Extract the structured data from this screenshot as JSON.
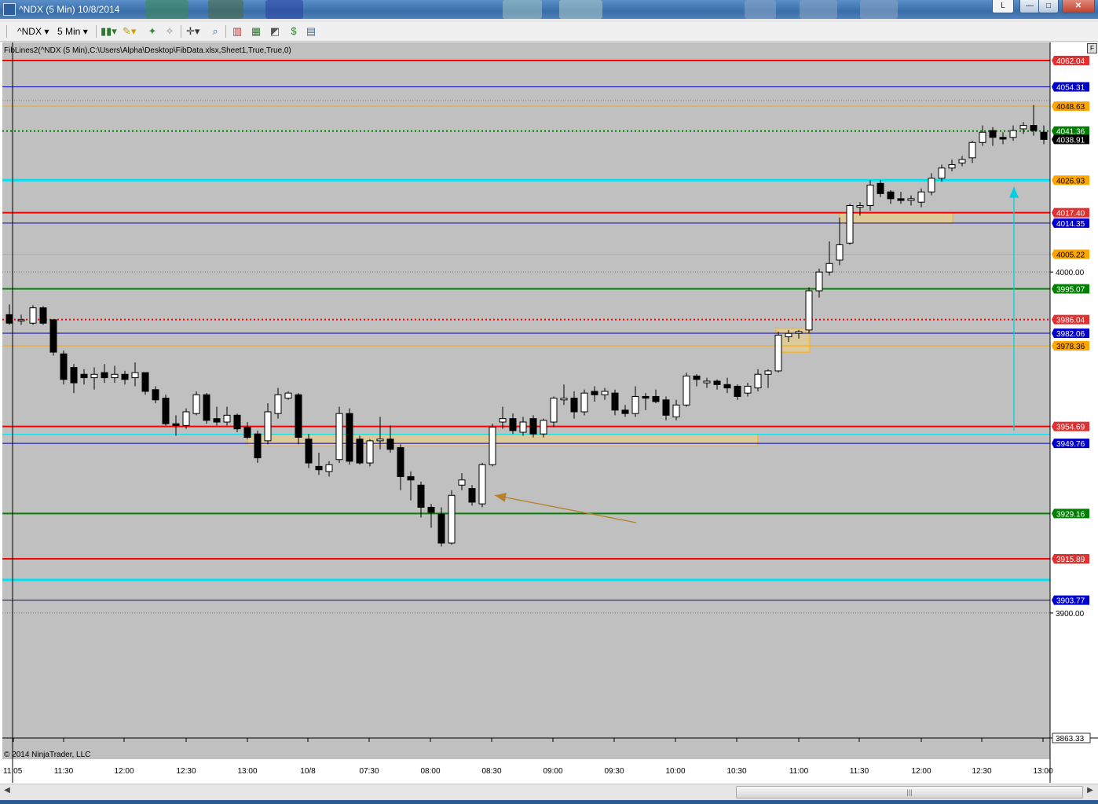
{
  "window": {
    "title": "^NDX (5 Min)  10/8/2014",
    "tab_label": "L",
    "min_glyph": "—",
    "max_glyph": "□",
    "close_glyph": "✕"
  },
  "toolbar": {
    "instrument": "^NDX",
    "interval": "5 Min",
    "icons": [
      "bar-type-icon",
      "drawing-pencil-icon",
      "crosshair-icon",
      "zoom-icon",
      "data-box-icon",
      "chart-properties-icon",
      "strategy-icon",
      "template-icon",
      "window-linking-icon"
    ]
  },
  "indicator_label": "FibLines2(^NDX (5 Min),C:\\Users\\Alpha\\Desktop\\FibData.xlsx,Sheet1,True,True,0)",
  "copyright": "© 2014 NinjaTrader, LLC",
  "corner_box": "F",
  "scroll_grip": "|||",
  "chart_data": {
    "type": "candlestick",
    "title": "^NDX (5 Min)  10/8/2014",
    "y_range": [
      3863.33,
      4066.5
    ],
    "x_labels": [
      "11:05",
      "11:30",
      "12:00",
      "12:30",
      "13:00",
      "10/8",
      "07:30",
      "08:00",
      "08:30",
      "09:00",
      "09:30",
      "10:00",
      "10:30",
      "11:00",
      "11:30",
      "12:00",
      "12:30",
      "13:00"
    ],
    "price_axis_plain": [
      "4000.00",
      "3900.00",
      "3863.33"
    ],
    "levels": [
      {
        "price": "4062.04",
        "color": "#ff0000",
        "style": "solid",
        "badge": "#e03030"
      },
      {
        "price": "4054.31",
        "color": "#0000b0",
        "style": "solid",
        "badge": "#0000cc"
      },
      {
        "price": "4048.63",
        "color": "#ffa500",
        "style": "solid",
        "badge": "#ffa500"
      },
      {
        "price": "4041.36",
        "color": "#008000",
        "style": "dotted",
        "badge": "#008000"
      },
      {
        "price": "4038.91",
        "color": "#000000",
        "style": "none",
        "badge": "#000000"
      },
      {
        "price": "4026.93",
        "color": "#00e0f0",
        "style": "thick",
        "badge": "#ffa500"
      },
      {
        "price": "4017.40",
        "color": "#ff0000",
        "style": "solid",
        "badge": "#e03030"
      },
      {
        "price": "4014.35",
        "color": "#0000b0",
        "style": "solid",
        "badge": "#0000cc"
      },
      {
        "price": "4005.22",
        "color": "#ffa500",
        "style": "solid",
        "badge": "#ffa500"
      },
      {
        "price": "3995.07",
        "color": "#008000",
        "style": "solid",
        "badge": "#008000"
      },
      {
        "price": "3986.04",
        "color": "#ff0000",
        "style": "dotted",
        "badge": "#e03030"
      },
      {
        "price": "3982.06",
        "color": "#0000b0",
        "style": "solid",
        "badge": "#0000cc"
      },
      {
        "price": "3978.36",
        "color": "#ffa500",
        "style": "solid",
        "badge": "#ffa500"
      },
      {
        "price": "3954.69",
        "color": "#ff0000",
        "style": "solid",
        "badge": "#e03030"
      },
      {
        "price": "3949.76",
        "color": "#0000b0",
        "style": "solid",
        "badge": "#0000cc"
      },
      {
        "price": "3929.16",
        "color": "#008000",
        "style": "solid",
        "badge": "#008000"
      },
      {
        "price": "3915.89",
        "color": "#ff0000",
        "style": "solid",
        "badge": "#e03030"
      },
      {
        "price": "3903.77",
        "color": "#0000b0",
        "style": "solid",
        "badge": "#0000cc"
      }
    ],
    "extra_lines": [
      {
        "price": 3909.7,
        "color": "#00e0f0",
        "style": "thick"
      },
      {
        "price": 3952.4,
        "color": "#00e0f0",
        "style": "thin"
      }
    ],
    "candles": [
      {
        "t": 12,
        "o": 3987.5,
        "h": 3990.5,
        "l": 3984.5,
        "c": 3985.0
      },
      {
        "t": 27,
        "o": 3986.0,
        "h": 3987.5,
        "l": 3984.5,
        "c": 3986.0
      },
      {
        "t": 42,
        "o": 3985.0,
        "h": 3990.3,
        "l": 3984.5,
        "c": 3989.5
      },
      {
        "t": 55,
        "o": 3989.5,
        "h": 3990.0,
        "l": 3984.5,
        "c": 3985.0
      },
      {
        "t": 68,
        "o": 3986.0,
        "h": 3986.0,
        "l": 3975.5,
        "c": 3976.5
      },
      {
        "t": 81,
        "o": 3976.0,
        "h": 3977.0,
        "l": 3967.0,
        "c": 3968.5
      },
      {
        "t": 94,
        "o": 3972.0,
        "h": 3973.0,
        "l": 3964.5,
        "c": 3967.5
      },
      {
        "t": 107,
        "o": 3970.0,
        "h": 3971.5,
        "l": 3967.0,
        "c": 3969.0
      },
      {
        "t": 120,
        "o": 3969.0,
        "h": 3972.0,
        "l": 3965.5,
        "c": 3970.0
      },
      {
        "t": 133,
        "o": 3970.5,
        "h": 3973.0,
        "l": 3967.5,
        "c": 3969.0
      },
      {
        "t": 146,
        "o": 3969.0,
        "h": 3972.5,
        "l": 3967.5,
        "c": 3970.0
      },
      {
        "t": 159,
        "o": 3970.0,
        "h": 3971.0,
        "l": 3967.0,
        "c": 3968.5
      },
      {
        "t": 172,
        "o": 3969.0,
        "h": 3973.5,
        "l": 3966.5,
        "c": 3970.5
      },
      {
        "t": 185,
        "o": 3970.5,
        "h": 3970.5,
        "l": 3964.0,
        "c": 3965.0
      },
      {
        "t": 198,
        "o": 3965.5,
        "h": 3966.5,
        "l": 3961.5,
        "c": 3962.5
      },
      {
        "t": 211,
        "o": 3963.0,
        "h": 3964.0,
        "l": 3955.0,
        "c": 3955.5
      },
      {
        "t": 224,
        "o": 3955.5,
        "h": 3958.0,
        "l": 3952.0,
        "c": 3955.0
      },
      {
        "t": 237,
        "o": 3955.0,
        "h": 3960.0,
        "l": 3954.0,
        "c": 3959.0
      },
      {
        "t": 250,
        "o": 3958.5,
        "h": 3965.0,
        "l": 3958.0,
        "c": 3964.0
      },
      {
        "t": 263,
        "o": 3964.0,
        "h": 3964.5,
        "l": 3955.5,
        "c": 3956.5
      },
      {
        "t": 276,
        "o": 3957.0,
        "h": 3960.5,
        "l": 3955.0,
        "c": 3956.0
      },
      {
        "t": 289,
        "o": 3956.0,
        "h": 3960.5,
        "l": 3955.0,
        "c": 3958.0
      },
      {
        "t": 302,
        "o": 3958.0,
        "h": 3958.5,
        "l": 3953.0,
        "c": 3954.0
      },
      {
        "t": 315,
        "o": 3954.5,
        "h": 3956.0,
        "l": 3951.0,
        "c": 3951.5
      },
      {
        "t": 328,
        "o": 3952.5,
        "h": 3953.5,
        "l": 3944.0,
        "c": 3945.5
      },
      {
        "t": 341,
        "o": 3950.5,
        "h": 3961.5,
        "l": 3949.5,
        "c": 3959.0
      },
      {
        "t": 354,
        "o": 3958.5,
        "h": 3966.0,
        "l": 3957.0,
        "c": 3964.0
      },
      {
        "t": 367,
        "o": 3963.0,
        "h": 3965.0,
        "l": 3962.5,
        "c": 3964.5
      },
      {
        "t": 380,
        "o": 3964.0,
        "h": 3964.5,
        "l": 3949.5,
        "c": 3951.5
      },
      {
        "t": 393,
        "o": 3951.0,
        "h": 3952.5,
        "l": 3942.5,
        "c": 3944.0
      },
      {
        "t": 406,
        "o": 3943.0,
        "h": 3947.0,
        "l": 3940.5,
        "c": 3942.0
      },
      {
        "t": 419,
        "o": 3941.5,
        "h": 3944.5,
        "l": 3940.0,
        "c": 3943.5
      },
      {
        "t": 432,
        "o": 3945.0,
        "h": 3960.5,
        "l": 3944.0,
        "c": 3958.5
      },
      {
        "t": 445,
        "o": 3958.5,
        "h": 3960.0,
        "l": 3943.5,
        "c": 3944.5
      },
      {
        "t": 458,
        "o": 3951.0,
        "h": 3952.0,
        "l": 3943.5,
        "c": 3944.0
      },
      {
        "t": 471,
        "o": 3944.0,
        "h": 3951.0,
        "l": 3943.0,
        "c": 3950.5
      },
      {
        "t": 484,
        "o": 3950.5,
        "h": 3957.5,
        "l": 3948.0,
        "c": 3951.0
      },
      {
        "t": 497,
        "o": 3951.0,
        "h": 3955.0,
        "l": 3947.0,
        "c": 3948.0
      },
      {
        "t": 510,
        "o": 3948.5,
        "h": 3949.5,
        "l": 3936.0,
        "c": 3940.0
      },
      {
        "t": 523,
        "o": 3940.0,
        "h": 3941.5,
        "l": 3933.0,
        "c": 3939.0
      },
      {
        "t": 536,
        "o": 3937.5,
        "h": 3938.5,
        "l": 3928.0,
        "c": 3931.0
      },
      {
        "t": 549,
        "o": 3931.0,
        "h": 3932.0,
        "l": 3925.0,
        "c": 3929.5
      },
      {
        "t": 562,
        "o": 3929.0,
        "h": 3931.0,
        "l": 3919.5,
        "c": 3920.5
      },
      {
        "t": 575,
        "o": 3920.5,
        "h": 3936.0,
        "l": 3920.0,
        "c": 3934.5
      },
      {
        "t": 588,
        "o": 3937.5,
        "h": 3941.0,
        "l": 3936.0,
        "c": 3939.0
      },
      {
        "t": 601,
        "o": 3936.5,
        "h": 3937.5,
        "l": 3931.5,
        "c": 3932.5
      },
      {
        "t": 614,
        "o": 3932.0,
        "h": 3944.0,
        "l": 3931.0,
        "c": 3943.5
      },
      {
        "t": 627,
        "o": 3943.5,
        "h": 3955.5,
        "l": 3943.0,
        "c": 3954.5
      },
      {
        "t": 640,
        "o": 3956.0,
        "h": 3960.5,
        "l": 3954.0,
        "c": 3957.0
      },
      {
        "t": 653,
        "o": 3957.0,
        "h": 3958.5,
        "l": 3952.5,
        "c": 3953.5
      },
      {
        "t": 666,
        "o": 3953.0,
        "h": 3957.5,
        "l": 3952.0,
        "c": 3956.0
      },
      {
        "t": 679,
        "o": 3957.0,
        "h": 3958.0,
        "l": 3951.5,
        "c": 3952.5
      },
      {
        "t": 692,
        "o": 3952.5,
        "h": 3957.0,
        "l": 3951.5,
        "c": 3956.5
      },
      {
        "t": 705,
        "o": 3956.0,
        "h": 3963.5,
        "l": 3954.5,
        "c": 3963.0
      },
      {
        "t": 718,
        "o": 3962.5,
        "h": 3967.0,
        "l": 3961.0,
        "c": 3963.0
      },
      {
        "t": 731,
        "o": 3963.0,
        "h": 3965.0,
        "l": 3957.0,
        "c": 3959.0
      },
      {
        "t": 744,
        "o": 3959.0,
        "h": 3965.5,
        "l": 3958.0,
        "c": 3964.5
      },
      {
        "t": 757,
        "o": 3965.0,
        "h": 3966.5,
        "l": 3962.0,
        "c": 3964.0
      },
      {
        "t": 770,
        "o": 3964.0,
        "h": 3966.0,
        "l": 3962.5,
        "c": 3965.0
      },
      {
        "t": 783,
        "o": 3964.5,
        "h": 3965.5,
        "l": 3958.0,
        "c": 3959.5
      },
      {
        "t": 796,
        "o": 3959.5,
        "h": 3961.0,
        "l": 3957.5,
        "c": 3958.5
      },
      {
        "t": 809,
        "o": 3958.5,
        "h": 3966.5,
        "l": 3957.5,
        "c": 3963.5
      },
      {
        "t": 822,
        "o": 3963.5,
        "h": 3964.5,
        "l": 3959.5,
        "c": 3963.0
      },
      {
        "t": 835,
        "o": 3963.5,
        "h": 3965.5,
        "l": 3961.5,
        "c": 3962.0
      },
      {
        "t": 848,
        "o": 3962.5,
        "h": 3963.5,
        "l": 3956.5,
        "c": 3958.0
      },
      {
        "t": 861,
        "o": 3957.5,
        "h": 3962.5,
        "l": 3956.5,
        "c": 3961.0
      },
      {
        "t": 874,
        "o": 3961.0,
        "h": 3970.5,
        "l": 3960.5,
        "c": 3969.5
      },
      {
        "t": 887,
        "o": 3969.5,
        "h": 3970.0,
        "l": 3966.5,
        "c": 3968.5
      },
      {
        "t": 900,
        "o": 3967.5,
        "h": 3969.0,
        "l": 3966.0,
        "c": 3968.0
      },
      {
        "t": 913,
        "o": 3968.0,
        "h": 3968.5,
        "l": 3965.5,
        "c": 3967.0
      },
      {
        "t": 926,
        "o": 3967.0,
        "h": 3969.0,
        "l": 3964.5,
        "c": 3966.0
      },
      {
        "t": 939,
        "o": 3966.5,
        "h": 3967.0,
        "l": 3962.5,
        "c": 3963.5
      },
      {
        "t": 952,
        "o": 3964.5,
        "h": 3967.5,
        "l": 3963.5,
        "c": 3966.5
      },
      {
        "t": 965,
        "o": 3966.0,
        "h": 3971.5,
        "l": 3965.0,
        "c": 3970.0
      },
      {
        "t": 978,
        "o": 3970.0,
        "h": 3971.5,
        "l": 3966.0,
        "c": 3971.0
      },
      {
        "t": 991,
        "o": 3971.0,
        "h": 3982.5,
        "l": 3970.5,
        "c": 3981.5
      },
      {
        "t": 1004,
        "o": 3981.0,
        "h": 3983.0,
        "l": 3979.5,
        "c": 3982.0
      },
      {
        "t": 1017,
        "o": 3982.0,
        "h": 3983.0,
        "l": 3980.5,
        "c": 3982.5
      },
      {
        "t": 1030,
        "o": 3983.0,
        "h": 3995.5,
        "l": 3982.0,
        "c": 3994.5
      },
      {
        "t": 1043,
        "o": 3994.5,
        "h": 4001.0,
        "l": 3992.5,
        "c": 4000.0
      },
      {
        "t": 1056,
        "o": 4000.0,
        "h": 4009.0,
        "l": 3999.0,
        "c": 4002.5
      },
      {
        "t": 1069,
        "o": 4003.5,
        "h": 4016.0,
        "l": 4002.0,
        "c": 4008.0
      },
      {
        "t": 1082,
        "o": 4008.5,
        "h": 4020.0,
        "l": 4008.0,
        "c": 4019.5
      },
      {
        "t": 1095,
        "o": 4019.0,
        "h": 4020.5,
        "l": 4016.5,
        "c": 4019.5
      },
      {
        "t": 1108,
        "o": 4019.5,
        "h": 4027.0,
        "l": 4018.0,
        "c": 4025.5
      },
      {
        "t": 1121,
        "o": 4026.0,
        "h": 4027.0,
        "l": 4022.0,
        "c": 4023.0
      },
      {
        "t": 1134,
        "o": 4023.5,
        "h": 4024.0,
        "l": 4020.0,
        "c": 4021.5
      },
      {
        "t": 1147,
        "o": 4021.5,
        "h": 4023.5,
        "l": 4020.0,
        "c": 4021.0
      },
      {
        "t": 1160,
        "o": 4021.0,
        "h": 4022.5,
        "l": 4019.5,
        "c": 4021.5
      },
      {
        "t": 1173,
        "o": 4020.5,
        "h": 4024.5,
        "l": 4019.0,
        "c": 4023.5
      },
      {
        "t": 1186,
        "o": 4023.5,
        "h": 4029.0,
        "l": 4022.5,
        "c": 4027.5
      },
      {
        "t": 1199,
        "o": 4027.5,
        "h": 4031.5,
        "l": 4026.5,
        "c": 4030.5
      },
      {
        "t": 1212,
        "o": 4030.5,
        "h": 4033.0,
        "l": 4029.5,
        "c": 4031.5
      },
      {
        "t": 1225,
        "o": 4032.0,
        "h": 4034.0,
        "l": 4031.0,
        "c": 4033.0
      },
      {
        "t": 1238,
        "o": 4033.5,
        "h": 4038.5,
        "l": 4032.0,
        "c": 4038.0
      },
      {
        "t": 1251,
        "o": 4038.0,
        "h": 4043.0,
        "l": 4037.0,
        "c": 4041.0
      },
      {
        "t": 1264,
        "o": 4041.5,
        "h": 4042.5,
        "l": 4037.0,
        "c": 4039.5
      },
      {
        "t": 1277,
        "o": 4039.5,
        "h": 4041.0,
        "l": 4037.5,
        "c": 4039.0
      },
      {
        "t": 1290,
        "o": 4039.5,
        "h": 4043.0,
        "l": 4038.5,
        "c": 4041.5
      },
      {
        "t": 1303,
        "o": 4042.0,
        "h": 4044.0,
        "l": 4040.5,
        "c": 4043.0
      },
      {
        "t": 1316,
        "o": 4043.0,
        "h": 4049.0,
        "l": 4040.0,
        "c": 4041.5
      },
      {
        "t": 1329,
        "o": 4041.0,
        "h": 4043.0,
        "l": 4037.5,
        "c": 4038.9
      }
    ],
    "zones": [
      {
        "t1": 315,
        "t2": 965,
        "p1": 3952.4,
        "p2": 3949.0,
        "color": "#f2d27a"
      },
      {
        "t1": 988,
        "t2": 1031,
        "p1": 3983.5,
        "p2": 3976.5,
        "color": "#f2d27a"
      },
      {
        "t1": 1069,
        "t2": 1213,
        "p1": 4017.4,
        "p2": 4014.3,
        "color": "#f2d27a"
      }
    ],
    "arrows": [
      {
        "t1": 810,
        "p1": 3926.5,
        "t2": 630,
        "p2": 3934.5,
        "color": "#b5812a"
      },
      {
        "t1": 1291,
        "p1": 3953.5,
        "t2": 1291,
        "p2": 4025.0,
        "color": "#00cfe0"
      }
    ]
  }
}
